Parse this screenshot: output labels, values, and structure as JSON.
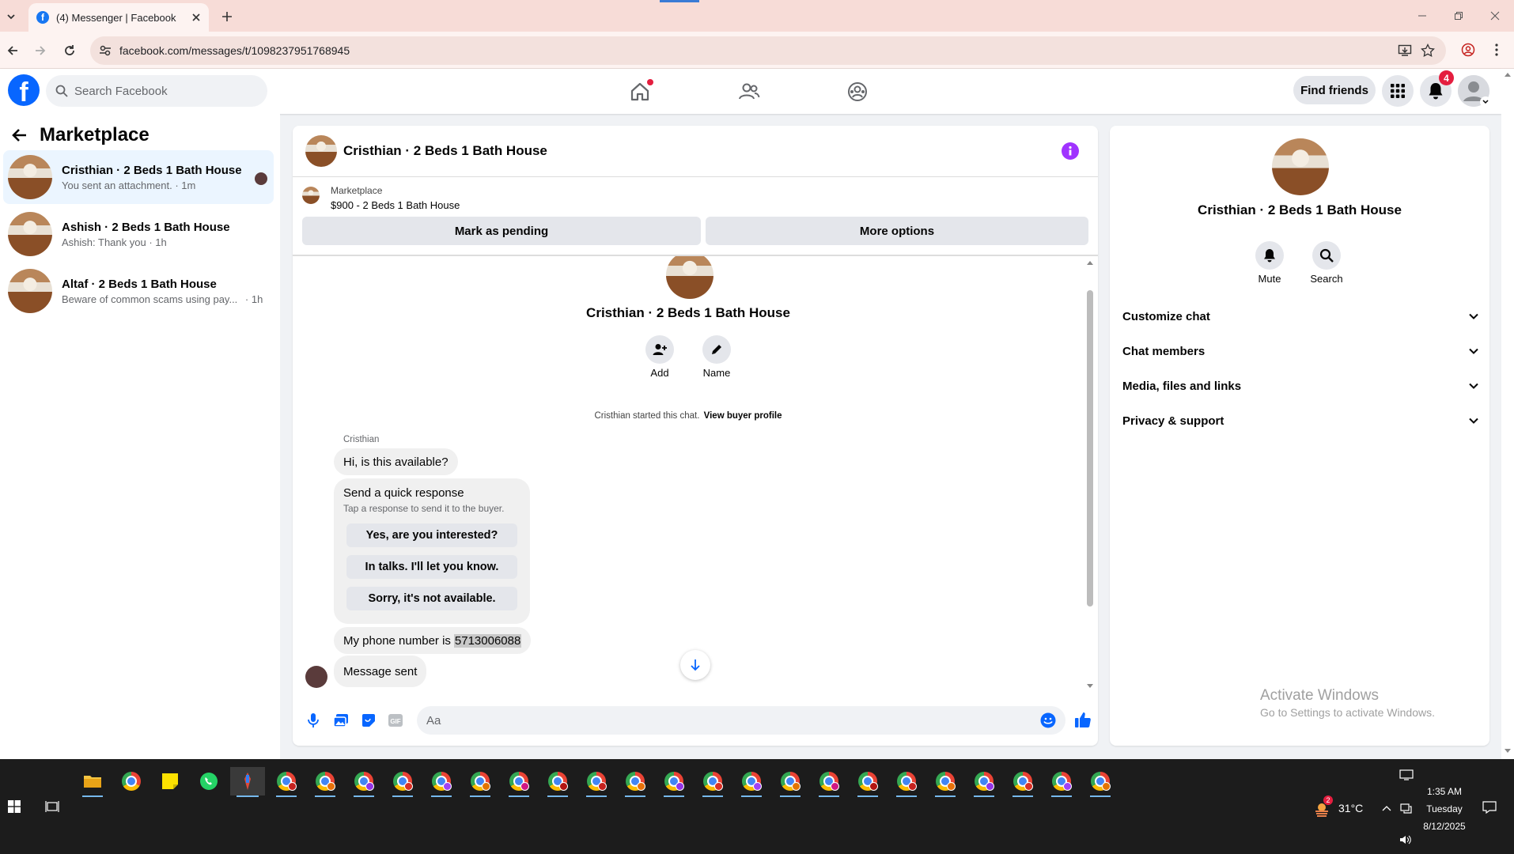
{
  "browser": {
    "tab_title": "(4) Messenger | Facebook",
    "url": "facebook.com/messages/t/1098237951768945"
  },
  "header": {
    "search_placeholder": "Search Facebook",
    "find_friends": "Find friends",
    "notification_count": "4"
  },
  "sidebar": {
    "title": "Marketplace",
    "threads": [
      {
        "name": "Cristhian · 2 Beds 1 Bath House",
        "preview": "You sent an attachment. · 1m",
        "selected": true
      },
      {
        "name": "Ashish · 2 Beds 1 Bath House",
        "preview": "Ashish: Thank you · 1h",
        "selected": false
      },
      {
        "name": "Altaf · 2 Beds 1 Bath House",
        "preview": "Beware of common scams using pay...",
        "time": "· 1h",
        "selected": false
      }
    ]
  },
  "chat": {
    "title": "Cristhian · 2 Beds 1 Bath House",
    "listing_source": "Marketplace",
    "listing_summary": "$900 - 2 Beds 1 Bath House",
    "mark_pending": "Mark as pending",
    "more_options": "More options",
    "profile_name": "Cristhian · 2 Beds 1 Bath House",
    "add_label": "Add",
    "name_label": "Name",
    "started_text": "Cristhian started this chat.",
    "view_buyer_profile": "View buyer profile",
    "sender_name": "Cristhian",
    "message_1": "Hi, is this available?",
    "quick_response": {
      "title": "Send a quick response",
      "subtitle": "Tap a response to send it to the buyer.",
      "options": [
        "Yes, are you interested?",
        "In talks. I'll let you know.",
        "Sorry, it's not available."
      ]
    },
    "phone_prefix": "My phone number is ",
    "phone_number": "5713006088",
    "message_sent": "Message sent",
    "composer_placeholder": "Aa"
  },
  "details": {
    "name": "Cristhian · 2 Beds 1 Bath House",
    "mute": "Mute",
    "search": "Search",
    "sections": [
      "Customize chat",
      "Chat members",
      "Media, files and links",
      "Privacy & support"
    ]
  },
  "watermark": {
    "line1": "Activate Windows",
    "line2": "Go to Settings to activate Windows."
  },
  "taskbar": {
    "weather_badge": "2",
    "temperature": "31°C",
    "time": "1:35 AM",
    "day": "Tuesday",
    "date": "8/12/2025"
  },
  "colors": {
    "fb_blue": "#0866ff",
    "chrome_tabstrip": "#f7dcd7",
    "badge_red": "#e41e3f",
    "info_purple": "#a033ff",
    "selected_thread": "#ebf5ff"
  }
}
